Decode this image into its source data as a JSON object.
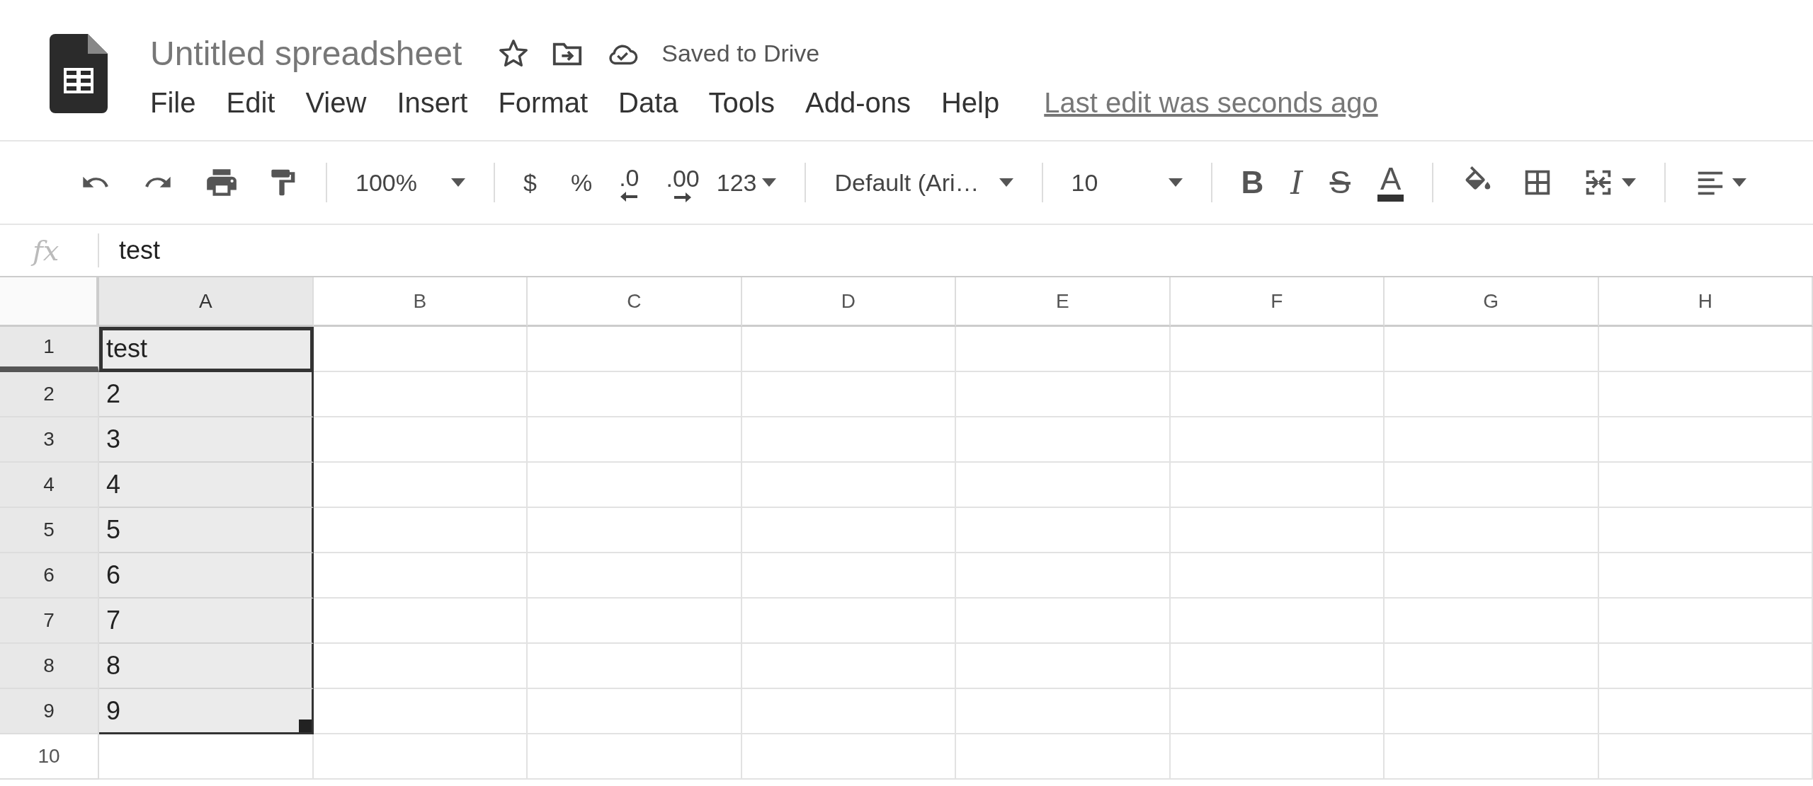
{
  "header": {
    "title": "Untitled spreadsheet",
    "save_status": "Saved to Drive",
    "menu": [
      "File",
      "Edit",
      "View",
      "Insert",
      "Format",
      "Data",
      "Tools",
      "Add-ons",
      "Help"
    ],
    "last_edit": "Last edit was seconds ago"
  },
  "toolbar": {
    "zoom": "100%",
    "currency": "$",
    "percent": "%",
    "decrease_decimals": ".0",
    "increase_decimals": ".00",
    "number_format": "123",
    "font": "Default (Ari…",
    "font_size": "10",
    "bold": "B",
    "italic": "I",
    "strikethrough": "S",
    "text_color": "A"
  },
  "formula_bar": {
    "label": "fx",
    "value": "test"
  },
  "grid": {
    "columns": [
      {
        "label": "A",
        "selected": true
      },
      {
        "label": "B",
        "selected": false
      },
      {
        "label": "C",
        "selected": false
      },
      {
        "label": "D",
        "selected": false
      },
      {
        "label": "E",
        "selected": false
      },
      {
        "label": "F",
        "selected": false
      },
      {
        "label": "G",
        "selected": false
      },
      {
        "label": "H",
        "selected": false
      }
    ],
    "rows": [
      {
        "label": "1",
        "selected": true,
        "active": true,
        "value": "test"
      },
      {
        "label": "2",
        "selected": true,
        "active": false,
        "value": "2"
      },
      {
        "label": "3",
        "selected": true,
        "active": false,
        "value": "3"
      },
      {
        "label": "4",
        "selected": true,
        "active": false,
        "value": "4"
      },
      {
        "label": "5",
        "selected": true,
        "active": false,
        "value": "5"
      },
      {
        "label": "6",
        "selected": true,
        "active": false,
        "value": "6"
      },
      {
        "label": "7",
        "selected": true,
        "active": false,
        "value": "7"
      },
      {
        "label": "8",
        "selected": true,
        "active": false,
        "value": "8"
      },
      {
        "label": "9",
        "selected": true,
        "active": false,
        "value": "9"
      },
      {
        "label": "10",
        "selected": false,
        "active": false
      }
    ]
  }
}
